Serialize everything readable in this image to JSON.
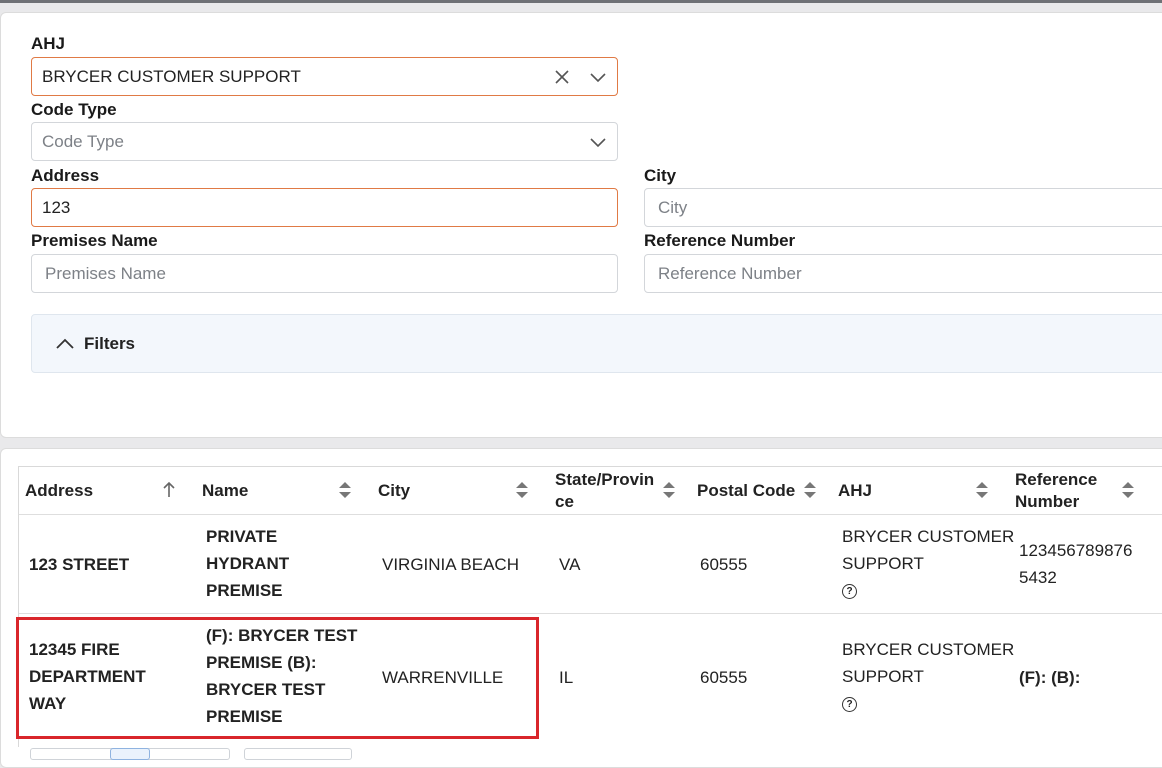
{
  "form": {
    "ahj": {
      "label": "AHJ",
      "value": "BRYCER CUSTOMER SUPPORT"
    },
    "code_type": {
      "label": "Code Type",
      "placeholder": "Code Type"
    },
    "address": {
      "label": "Address",
      "value": "123"
    },
    "city": {
      "label": "City",
      "placeholder": "City"
    },
    "premises_name": {
      "label": "Premises Name",
      "placeholder": "Premises Name"
    },
    "reference_number": {
      "label": "Reference Number",
      "placeholder": "Reference Number"
    },
    "filters_label": "Filters"
  },
  "table": {
    "columns": [
      "Address",
      "Name",
      "City",
      "State/Province",
      "Postal Code",
      "AHJ",
      "Reference Number"
    ],
    "state_header_lines": [
      "State/Provin",
      "ce"
    ],
    "reference_header_lines": [
      "Reference",
      "Number"
    ],
    "rows": [
      {
        "address_lines": [
          "123 STREET"
        ],
        "name_lines": [
          "PRIVATE",
          "HYDRANT",
          "PREMISE"
        ],
        "city": "VIRGINIA BEACH",
        "state": "VA",
        "postal": "60555",
        "ahj_lines": [
          "BRYCER CUSTOMER",
          "SUPPORT"
        ],
        "reference_lines": [
          "123456789876",
          "5432"
        ]
      },
      {
        "address_lines": [
          "12345 FIRE",
          "DEPARTMENT",
          "WAY"
        ],
        "name_lines": [
          "(F): BRYCER TEST",
          "PREMISE (B):",
          "BRYCER TEST",
          "PREMISE"
        ],
        "city": "WARRENVILLE",
        "state": "IL",
        "postal": "60555",
        "ahj_lines": [
          "BRYCER CUSTOMER",
          "SUPPORT"
        ],
        "reference_lines": [
          "(F): (B):"
        ]
      }
    ]
  },
  "colors": {
    "active_border": "#e07a45",
    "highlight": "#d9262b",
    "filters_bg": "#f3f7fc"
  },
  "icons": [
    "clear-icon",
    "chevron-down-icon",
    "chevron-up-icon",
    "sort-asc-icon",
    "sort-icon",
    "help-icon"
  ]
}
